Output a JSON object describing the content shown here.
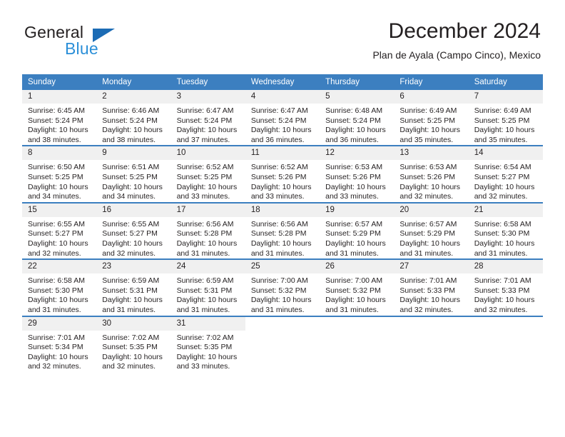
{
  "brand": {
    "name_part1": "General",
    "name_part2": "Blue",
    "triangle_color": "#1c6cb5",
    "blue_color": "#2b8fd8"
  },
  "header": {
    "title": "December 2024",
    "subtitle": "Plan de Ayala (Campo Cinco), Mexico"
  },
  "theme": {
    "header_row_color": "#3c7fc0",
    "daynum_background": "#f0f0f0",
    "text_color": "#231f20"
  },
  "calendar": {
    "weekday_headers": [
      "Sunday",
      "Monday",
      "Tuesday",
      "Wednesday",
      "Thursday",
      "Friday",
      "Saturday"
    ],
    "weeks": [
      [
        {
          "day": "1",
          "sunrise": "Sunrise: 6:45 AM",
          "sunset": "Sunset: 5:24 PM",
          "daylight_line1": "Daylight: 10 hours",
          "daylight_line2": "and 38 minutes."
        },
        {
          "day": "2",
          "sunrise": "Sunrise: 6:46 AM",
          "sunset": "Sunset: 5:24 PM",
          "daylight_line1": "Daylight: 10 hours",
          "daylight_line2": "and 38 minutes."
        },
        {
          "day": "3",
          "sunrise": "Sunrise: 6:47 AM",
          "sunset": "Sunset: 5:24 PM",
          "daylight_line1": "Daylight: 10 hours",
          "daylight_line2": "and 37 minutes."
        },
        {
          "day": "4",
          "sunrise": "Sunrise: 6:47 AM",
          "sunset": "Sunset: 5:24 PM",
          "daylight_line1": "Daylight: 10 hours",
          "daylight_line2": "and 36 minutes."
        },
        {
          "day": "5",
          "sunrise": "Sunrise: 6:48 AM",
          "sunset": "Sunset: 5:24 PM",
          "daylight_line1": "Daylight: 10 hours",
          "daylight_line2": "and 36 minutes."
        },
        {
          "day": "6",
          "sunrise": "Sunrise: 6:49 AM",
          "sunset": "Sunset: 5:25 PM",
          "daylight_line1": "Daylight: 10 hours",
          "daylight_line2": "and 35 minutes."
        },
        {
          "day": "7",
          "sunrise": "Sunrise: 6:49 AM",
          "sunset": "Sunset: 5:25 PM",
          "daylight_line1": "Daylight: 10 hours",
          "daylight_line2": "and 35 minutes."
        }
      ],
      [
        {
          "day": "8",
          "sunrise": "Sunrise: 6:50 AM",
          "sunset": "Sunset: 5:25 PM",
          "daylight_line1": "Daylight: 10 hours",
          "daylight_line2": "and 34 minutes."
        },
        {
          "day": "9",
          "sunrise": "Sunrise: 6:51 AM",
          "sunset": "Sunset: 5:25 PM",
          "daylight_line1": "Daylight: 10 hours",
          "daylight_line2": "and 34 minutes."
        },
        {
          "day": "10",
          "sunrise": "Sunrise: 6:52 AM",
          "sunset": "Sunset: 5:25 PM",
          "daylight_line1": "Daylight: 10 hours",
          "daylight_line2": "and 33 minutes."
        },
        {
          "day": "11",
          "sunrise": "Sunrise: 6:52 AM",
          "sunset": "Sunset: 5:26 PM",
          "daylight_line1": "Daylight: 10 hours",
          "daylight_line2": "and 33 minutes."
        },
        {
          "day": "12",
          "sunrise": "Sunrise: 6:53 AM",
          "sunset": "Sunset: 5:26 PM",
          "daylight_line1": "Daylight: 10 hours",
          "daylight_line2": "and 33 minutes."
        },
        {
          "day": "13",
          "sunrise": "Sunrise: 6:53 AM",
          "sunset": "Sunset: 5:26 PM",
          "daylight_line1": "Daylight: 10 hours",
          "daylight_line2": "and 32 minutes."
        },
        {
          "day": "14",
          "sunrise": "Sunrise: 6:54 AM",
          "sunset": "Sunset: 5:27 PM",
          "daylight_line1": "Daylight: 10 hours",
          "daylight_line2": "and 32 minutes."
        }
      ],
      [
        {
          "day": "15",
          "sunrise": "Sunrise: 6:55 AM",
          "sunset": "Sunset: 5:27 PM",
          "daylight_line1": "Daylight: 10 hours",
          "daylight_line2": "and 32 minutes."
        },
        {
          "day": "16",
          "sunrise": "Sunrise: 6:55 AM",
          "sunset": "Sunset: 5:27 PM",
          "daylight_line1": "Daylight: 10 hours",
          "daylight_line2": "and 32 minutes."
        },
        {
          "day": "17",
          "sunrise": "Sunrise: 6:56 AM",
          "sunset": "Sunset: 5:28 PM",
          "daylight_line1": "Daylight: 10 hours",
          "daylight_line2": "and 31 minutes."
        },
        {
          "day": "18",
          "sunrise": "Sunrise: 6:56 AM",
          "sunset": "Sunset: 5:28 PM",
          "daylight_line1": "Daylight: 10 hours",
          "daylight_line2": "and 31 minutes."
        },
        {
          "day": "19",
          "sunrise": "Sunrise: 6:57 AM",
          "sunset": "Sunset: 5:29 PM",
          "daylight_line1": "Daylight: 10 hours",
          "daylight_line2": "and 31 minutes."
        },
        {
          "day": "20",
          "sunrise": "Sunrise: 6:57 AM",
          "sunset": "Sunset: 5:29 PM",
          "daylight_line1": "Daylight: 10 hours",
          "daylight_line2": "and 31 minutes."
        },
        {
          "day": "21",
          "sunrise": "Sunrise: 6:58 AM",
          "sunset": "Sunset: 5:30 PM",
          "daylight_line1": "Daylight: 10 hours",
          "daylight_line2": "and 31 minutes."
        }
      ],
      [
        {
          "day": "22",
          "sunrise": "Sunrise: 6:58 AM",
          "sunset": "Sunset: 5:30 PM",
          "daylight_line1": "Daylight: 10 hours",
          "daylight_line2": "and 31 minutes."
        },
        {
          "day": "23",
          "sunrise": "Sunrise: 6:59 AM",
          "sunset": "Sunset: 5:31 PM",
          "daylight_line1": "Daylight: 10 hours",
          "daylight_line2": "and 31 minutes."
        },
        {
          "day": "24",
          "sunrise": "Sunrise: 6:59 AM",
          "sunset": "Sunset: 5:31 PM",
          "daylight_line1": "Daylight: 10 hours",
          "daylight_line2": "and 31 minutes."
        },
        {
          "day": "25",
          "sunrise": "Sunrise: 7:00 AM",
          "sunset": "Sunset: 5:32 PM",
          "daylight_line1": "Daylight: 10 hours",
          "daylight_line2": "and 31 minutes."
        },
        {
          "day": "26",
          "sunrise": "Sunrise: 7:00 AM",
          "sunset": "Sunset: 5:32 PM",
          "daylight_line1": "Daylight: 10 hours",
          "daylight_line2": "and 31 minutes."
        },
        {
          "day": "27",
          "sunrise": "Sunrise: 7:01 AM",
          "sunset": "Sunset: 5:33 PM",
          "daylight_line1": "Daylight: 10 hours",
          "daylight_line2": "and 32 minutes."
        },
        {
          "day": "28",
          "sunrise": "Sunrise: 7:01 AM",
          "sunset": "Sunset: 5:33 PM",
          "daylight_line1": "Daylight: 10 hours",
          "daylight_line2": "and 32 minutes."
        }
      ],
      [
        {
          "day": "29",
          "sunrise": "Sunrise: 7:01 AM",
          "sunset": "Sunset: 5:34 PM",
          "daylight_line1": "Daylight: 10 hours",
          "daylight_line2": "and 32 minutes."
        },
        {
          "day": "30",
          "sunrise": "Sunrise: 7:02 AM",
          "sunset": "Sunset: 5:35 PM",
          "daylight_line1": "Daylight: 10 hours",
          "daylight_line2": "and 32 minutes."
        },
        {
          "day": "31",
          "sunrise": "Sunrise: 7:02 AM",
          "sunset": "Sunset: 5:35 PM",
          "daylight_line1": "Daylight: 10 hours",
          "daylight_line2": "and 33 minutes."
        },
        {
          "day": "",
          "sunrise": "",
          "sunset": "",
          "daylight_line1": "",
          "daylight_line2": ""
        },
        {
          "day": "",
          "sunrise": "",
          "sunset": "",
          "daylight_line1": "",
          "daylight_line2": ""
        },
        {
          "day": "",
          "sunrise": "",
          "sunset": "",
          "daylight_line1": "",
          "daylight_line2": ""
        },
        {
          "day": "",
          "sunrise": "",
          "sunset": "",
          "daylight_line1": "",
          "daylight_line2": ""
        }
      ]
    ]
  }
}
